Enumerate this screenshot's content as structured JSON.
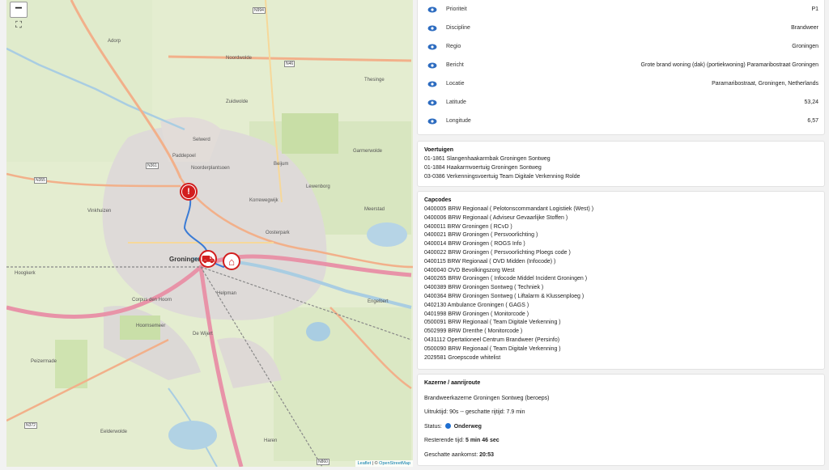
{
  "map": {
    "zoom_out_label": "−",
    "fullscreen_icon": "⛶",
    "labels": {
      "groningen": "Groningen",
      "adorp": "Adorp",
      "noordwolde": "Noordwolde",
      "zuidwolde": "Zuidwolde",
      "thesinge": "Thesinge",
      "garmerwolde": "Garmerwolde",
      "meerstad": "Meerstad",
      "engelbert": "Engelbert",
      "hoogkerk": "Hoogkerk",
      "peizermade": "Peizermade",
      "eelderwolde": "Eelderwolde",
      "haren": "Haren",
      "paddepoel": "Paddepoel",
      "vinkhuizen": "Vinkhuizen",
      "selwerd": "Selwerd",
      "beijum": "Beijum",
      "lewenborg": "Lewenborg",
      "korrewegwijk": "Korrewegwijk",
      "oosterpark": "Oosterpark",
      "helpman": "Helpman",
      "corpus": "Corpus den Hoorn",
      "hoornsemeer": "Hoornsemeer",
      "de_wijert": "De Wijert",
      "noorderplantsoen": "Noorderplantsoen"
    },
    "roads": {
      "n994": "N994",
      "n46": "N46",
      "n361": "N361",
      "n355": "N355",
      "n372": "N372",
      "n860": "N860"
    },
    "attribution": {
      "leaflet": "Leaflet",
      "sep": " | © ",
      "osm": "OpenStreetMap"
    },
    "markers": {
      "incident_icon": "exclamation-marker-icon",
      "vehicle_icon": "fire-truck-marker-icon",
      "station_icon": "fire-station-marker-icon"
    }
  },
  "details": [
    {
      "label": "Prioriteit",
      "value": "P1"
    },
    {
      "label": "Discipline",
      "value": "Brandweer"
    },
    {
      "label": "Regio",
      "value": "Groningen"
    },
    {
      "label": "Bericht",
      "value": "Grote brand woning (dak) (portiekwoning) Paramaribostraat Groningen"
    },
    {
      "label": "Locatie",
      "value": "Paramaribostraat, Groningen, Netherlands"
    },
    {
      "label": "Latitude",
      "value": "53,24"
    },
    {
      "label": "Longitude",
      "value": "6,57"
    }
  ],
  "voertuigen": {
    "title": "Voertuigen",
    "items": [
      "01-1861 Slangenhaakarmbak Groningen Sontweg",
      "01-1884 Haakarmvoertuig Groningen Sontweg",
      "03-0386 Verkenningsvoertuig Team Digitale Verkenning Rolde"
    ]
  },
  "capcodes": {
    "title": "Capcodes",
    "items": [
      "0400005 BRW Regionaal ( Pelotonscommandant Logistiek (West) )",
      "0400006 BRW Regionaal ( Adviseur Gevaarlijke Stoffen )",
      "0400011 BRW Groningen ( RCvD )",
      "0400021 BRW Groningen ( Persvoorlichting )",
      "0400014 BRW Groningen ( ROGS Info )",
      "0400022 BRW Groningen ( Persvoorlichting Ploegs code )",
      "0400115 BRW Regionaal ( OVD Midden (Infocode) )",
      "0400040 OVD Bevolkingszorg West",
      "0400265 BRW Groningen ( Infocode Middel Incident Groningen )",
      "0400389 BRW Groningen Sontweg ( Techniek )",
      "0400364 BRW Groningen Sontweg ( Liftalarm & Klussenploeg )",
      "0402130 Ambulance Groningen ( GAGS )",
      "0401998 BRW Groningen ( Monitorcode )",
      "0500091 BRW Regionaal ( Team Digitale Verkenning )",
      "0502999 BRW Drenthe ( Monitorcode )",
      "0431112 Opertationeel Centrum Brandweer (Persinfo)",
      "0500090 BRW Regionaal ( Team Digitale Verkenning )",
      "2029581 Groepscode whitelist"
    ]
  },
  "kazerne": {
    "title": "Kazerne / aanrijroute",
    "name": "Brandweerkazerne Groningen Sontweg (beroeps)",
    "timing": "Uitruktijd: 90s -- geschatte rijtijd: 7.9 min",
    "status_label": "Status:",
    "status_value": "Onderweg",
    "remaining_label": "Resterende tijd:",
    "remaining_value": "5 min 46 sec",
    "arrival_label": "Geschatte aankomst:",
    "arrival_value": "20:53",
    "status_color": "#1f6fd1"
  },
  "colors": {
    "marker_red": "#d21e1e",
    "route_blue": "#3a7bd5"
  }
}
